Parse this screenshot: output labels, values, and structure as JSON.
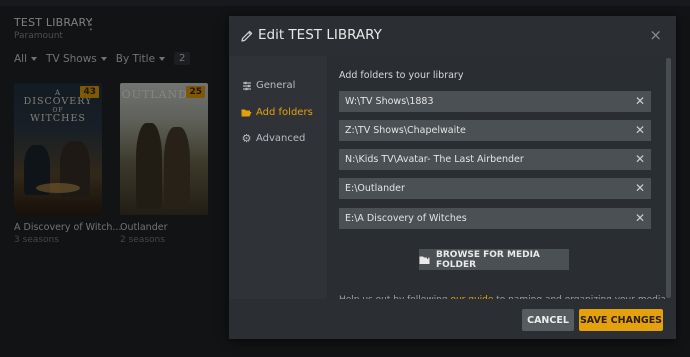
{
  "library": {
    "title": "TEST LIBRARY",
    "subtitle": "Paramount",
    "more_icon": "more-vertical-icon",
    "filters": {
      "all": "All",
      "type": "TV Shows",
      "sort": "By Title",
      "count": "2"
    },
    "items": [
      {
        "poster_title": "A DISCOVERY OF WITCHES",
        "poster_line1": "A",
        "poster_line2": "DISCOVERY",
        "poster_line3": "OF",
        "poster_line4": "WITCHES",
        "badge": "43",
        "title": "A Discovery of Witch...",
        "subtitle": "3 seasons"
      },
      {
        "poster_title": "OUTLANDER",
        "badge": "25",
        "title": "Outlander",
        "subtitle": "2 seasons"
      }
    ]
  },
  "modal": {
    "title": "Edit TEST LIBRARY",
    "close": "×",
    "nav": [
      {
        "label": "General",
        "icon": "sliders-icon"
      },
      {
        "label": "Add folders",
        "icon": "folder-open-icon"
      },
      {
        "label": "Advanced",
        "icon": "gear-icon"
      }
    ],
    "content": {
      "label": "Add folders to your library",
      "folders": [
        "W:\\TV Shows\\1883",
        "Z:\\TV Shows\\Chapelwaite",
        "N:\\Kids TV\\Avatar- The Last Airbender",
        "E:\\Outlander",
        "E:\\A Discovery of Witches"
      ],
      "browse_label": "BROWSE FOR MEDIA FOLDER",
      "help_prefix": "Help us out by following ",
      "help_link": "our guide",
      "help_suffix": " to naming and organizing your media."
    },
    "footer": {
      "cancel": "CANCEL",
      "save": "SAVE CHANGES"
    }
  },
  "colors": {
    "accent": "#e5a00d",
    "background": "#1f2326",
    "modal": "#34383c"
  }
}
